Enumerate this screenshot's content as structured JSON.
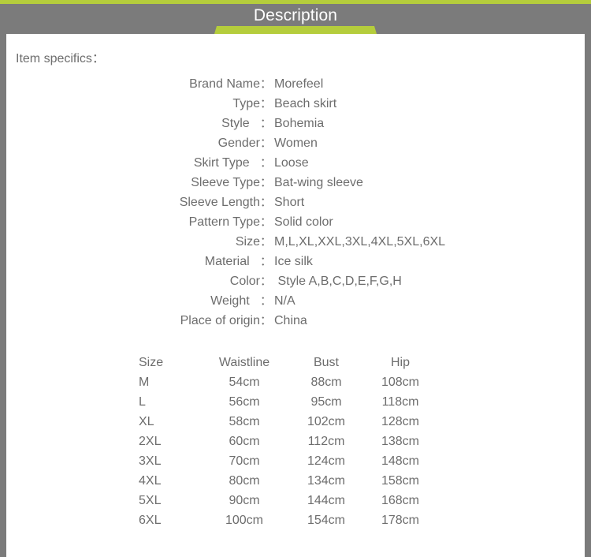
{
  "header": {
    "title": "Description",
    "accent_color": "#b5cd3c",
    "band_color": "#7b7b7b",
    "title_color": "#ffffff"
  },
  "content": {
    "section_heading": "Item specifics：",
    "text_color": "#6d6d6d"
  },
  "specs": [
    {
      "label": "Brand Name",
      "colon": "：",
      "value": "Morefeel"
    },
    {
      "label": "Type",
      "colon": "：",
      "value": "Beach skirt"
    },
    {
      "label": "Style   ",
      "colon": "：",
      "value": "Bohemia"
    },
    {
      "label": "Gender",
      "colon": "：",
      "value": "Women"
    },
    {
      "label": "Skirt Type   ",
      "colon": "：",
      "value": "Loose"
    },
    {
      "label": "Sleeve Type",
      "colon": "：",
      "value": "Bat-wing sleeve"
    },
    {
      "label": "Sleeve Length",
      "colon": "：",
      "value": "Short"
    },
    {
      "label": "Pattern Type",
      "colon": "：",
      "value": "Solid color"
    },
    {
      "label": "Size",
      "colon": "：",
      "value": "M,L,XL,XXL,3XL,4XL,5XL,6XL"
    },
    {
      "label": "Material   ",
      "colon": "：",
      "value": "Ice silk"
    },
    {
      "label": "Color",
      "colon": "：",
      "value": " Style A,B,C,D,E,F,G,H"
    },
    {
      "label": "Weight   ",
      "colon": "：",
      "value": "N/A"
    },
    {
      "label": "Place of origin",
      "colon": "：",
      "value": "China"
    }
  ],
  "size_table": {
    "columns": [
      "Size",
      "Waistline",
      "Bust",
      "Hip"
    ],
    "rows": [
      [
        "M",
        "54cm",
        "88cm",
        "108cm"
      ],
      [
        "L",
        "56cm",
        "95cm",
        "118cm"
      ],
      [
        "XL",
        "58cm",
        "102cm",
        "128cm"
      ],
      [
        "2XL",
        "60cm",
        "112cm",
        "138cm"
      ],
      [
        "3XL",
        "70cm",
        "124cm",
        "148cm"
      ],
      [
        "4XL",
        "80cm",
        "134cm",
        "158cm"
      ],
      [
        "5XL",
        "90cm",
        "144cm",
        "168cm"
      ],
      [
        "6XL",
        "100cm",
        "154cm",
        "178cm"
      ]
    ]
  }
}
